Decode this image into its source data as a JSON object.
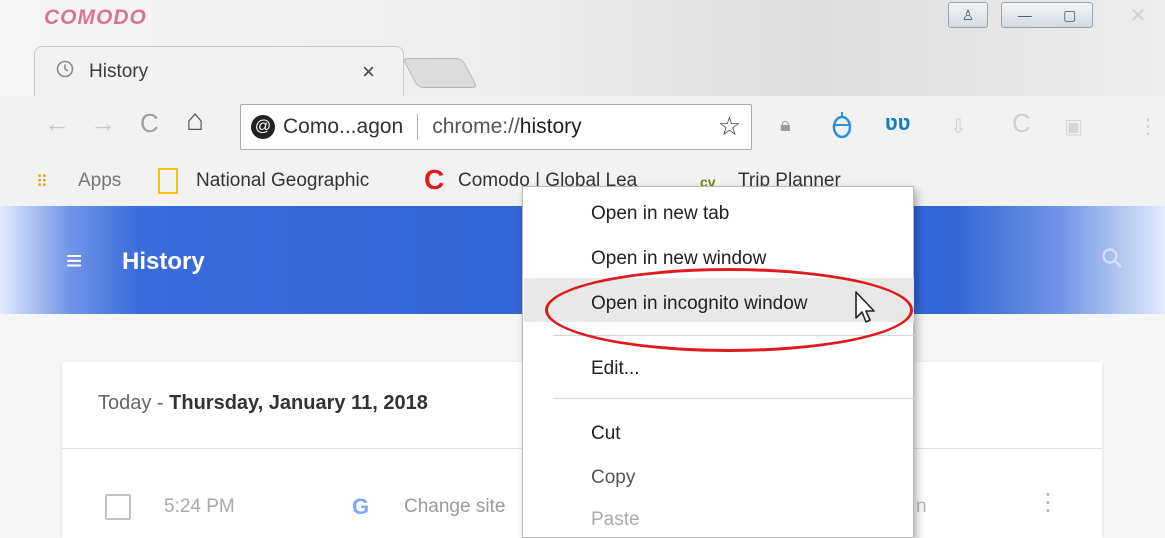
{
  "window": {
    "brand": "COMODO",
    "buttons": {
      "user": "♙",
      "minimize": "—",
      "maximize": "▢",
      "close": "✕"
    }
  },
  "tabs": [
    {
      "title": "History",
      "close": "×",
      "icon": "history-icon"
    }
  ],
  "toolbar": {
    "back": "←",
    "forward": "→",
    "reload": "C",
    "home": "⌂",
    "site_label": "Como...agon",
    "url_scheme": "chrome://",
    "url_path": "history",
    "star": "☆",
    "extensions": [
      "lock-icon",
      "shield-icon",
      "wave-icon",
      "download-icon",
      "comodo-icon",
      "puzzle-icon"
    ]
  },
  "bookmarks": [
    {
      "label": "Apps",
      "icon": "apps-icon"
    },
    {
      "label": "National Geographic",
      "icon": "bookmark-yellow-icon"
    },
    {
      "label": "Comodo | Global Lea",
      "icon": "comodo-c-icon"
    },
    {
      "label": "Trip Planner",
      "icon": "cv-icon"
    }
  ],
  "header": {
    "title": "History",
    "menu_glyph": "≡",
    "search_glyph": "⚲"
  },
  "content": {
    "date_prefix": "Today - ",
    "date_bold": "Thursday, January 11, 2018",
    "rows": [
      {
        "time": "5:24 PM",
        "favicon": "G",
        "title": "Change site",
        "trailing": "n",
        "more": "⋮"
      }
    ]
  },
  "context_menu": {
    "items": [
      {
        "label": "Open in new tab",
        "disabled": false
      },
      {
        "label": "Open in new window",
        "disabled": false
      },
      {
        "label": "Open in incognito window",
        "disabled": false,
        "highlighted": true
      },
      {
        "label": "Edit...",
        "disabled": false
      },
      {
        "label": "Cut",
        "disabled": false
      },
      {
        "label": "Copy",
        "disabled": false
      },
      {
        "label": "Paste",
        "disabled": true
      }
    ]
  },
  "colors": {
    "brand": "#c0103a",
    "header_blue": "#3366d6",
    "annotation_red": "#e0191f",
    "menu_hover": "#e8e8e8"
  }
}
